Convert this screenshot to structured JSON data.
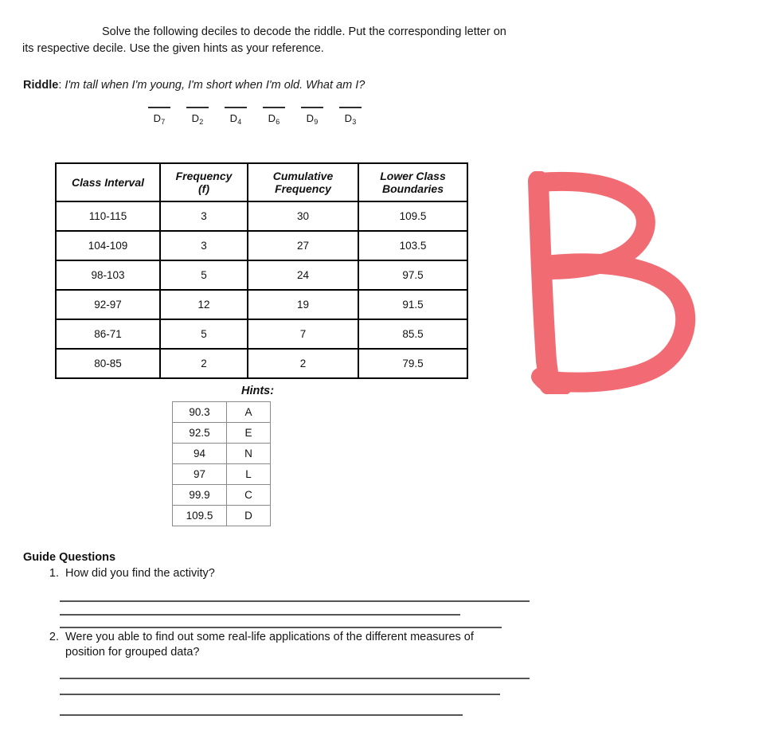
{
  "worksheet": {
    "instructions": "Solve the following deciles to decode the riddle. Put the corresponding letter on its respective decile. Use the given hints as your reference.",
    "riddle_label": "Riddle",
    "riddle_separator": ":",
    "riddle_text": "I'm tall when I'm young, I'm short when I'm old. What am I?"
  },
  "deciles": [
    {
      "base": "D",
      "sub": "7"
    },
    {
      "base": "D",
      "sub": "2"
    },
    {
      "base": "D",
      "sub": "4"
    },
    {
      "base": "D",
      "sub": "6"
    },
    {
      "base": "D",
      "sub": "9"
    },
    {
      "base": "D",
      "sub": "3"
    }
  ],
  "frequency_table": {
    "headers": [
      "Class Interval",
      "Frequency\n(f)",
      "Cumulative\nFrequency",
      "Lower Class\nBoundaries"
    ],
    "header_lines": [
      [
        "Class Interval"
      ],
      [
        "Frequency",
        "(f)"
      ],
      [
        "Cumulative",
        "Frequency"
      ],
      [
        "Lower Class",
        "Boundaries"
      ]
    ],
    "rows": [
      {
        "class_interval": "110-115",
        "frequency": "3",
        "cumulative_frequency": "30",
        "lower_class_boundary": "109.5"
      },
      {
        "class_interval": "104-109",
        "frequency": "3",
        "cumulative_frequency": "27",
        "lower_class_boundary": "103.5"
      },
      {
        "class_interval": "98-103",
        "frequency": "5",
        "cumulative_frequency": "24",
        "lower_class_boundary": "97.5"
      },
      {
        "class_interval": "92-97",
        "frequency": "12",
        "cumulative_frequency": "19",
        "lower_class_boundary": "91.5"
      },
      {
        "class_interval": "86-71",
        "frequency": "5",
        "cumulative_frequency": "7",
        "lower_class_boundary": "85.5"
      },
      {
        "class_interval": "80-85",
        "frequency": "2",
        "cumulative_frequency": "2",
        "lower_class_boundary": "79.5"
      }
    ]
  },
  "hints": {
    "title": "Hints:",
    "rows": [
      {
        "value": "90.3",
        "letter": "A"
      },
      {
        "value": "92.5",
        "letter": "E"
      },
      {
        "value": "94",
        "letter": "N"
      },
      {
        "value": "97",
        "letter": "L"
      },
      {
        "value": "99.9",
        "letter": "C"
      },
      {
        "value": "109.5",
        "letter": "D"
      }
    ]
  },
  "guide_questions": {
    "title": "Guide Questions",
    "items": [
      {
        "number": "1.",
        "text": "How did you find the activity?"
      },
      {
        "number": "2.",
        "text": "Were you able to find out some real-life applications of the different measures of position for grouped data?"
      }
    ]
  },
  "annotation": {
    "letter": "B",
    "color": "#ef4b55",
    "opacity": 0.82
  }
}
